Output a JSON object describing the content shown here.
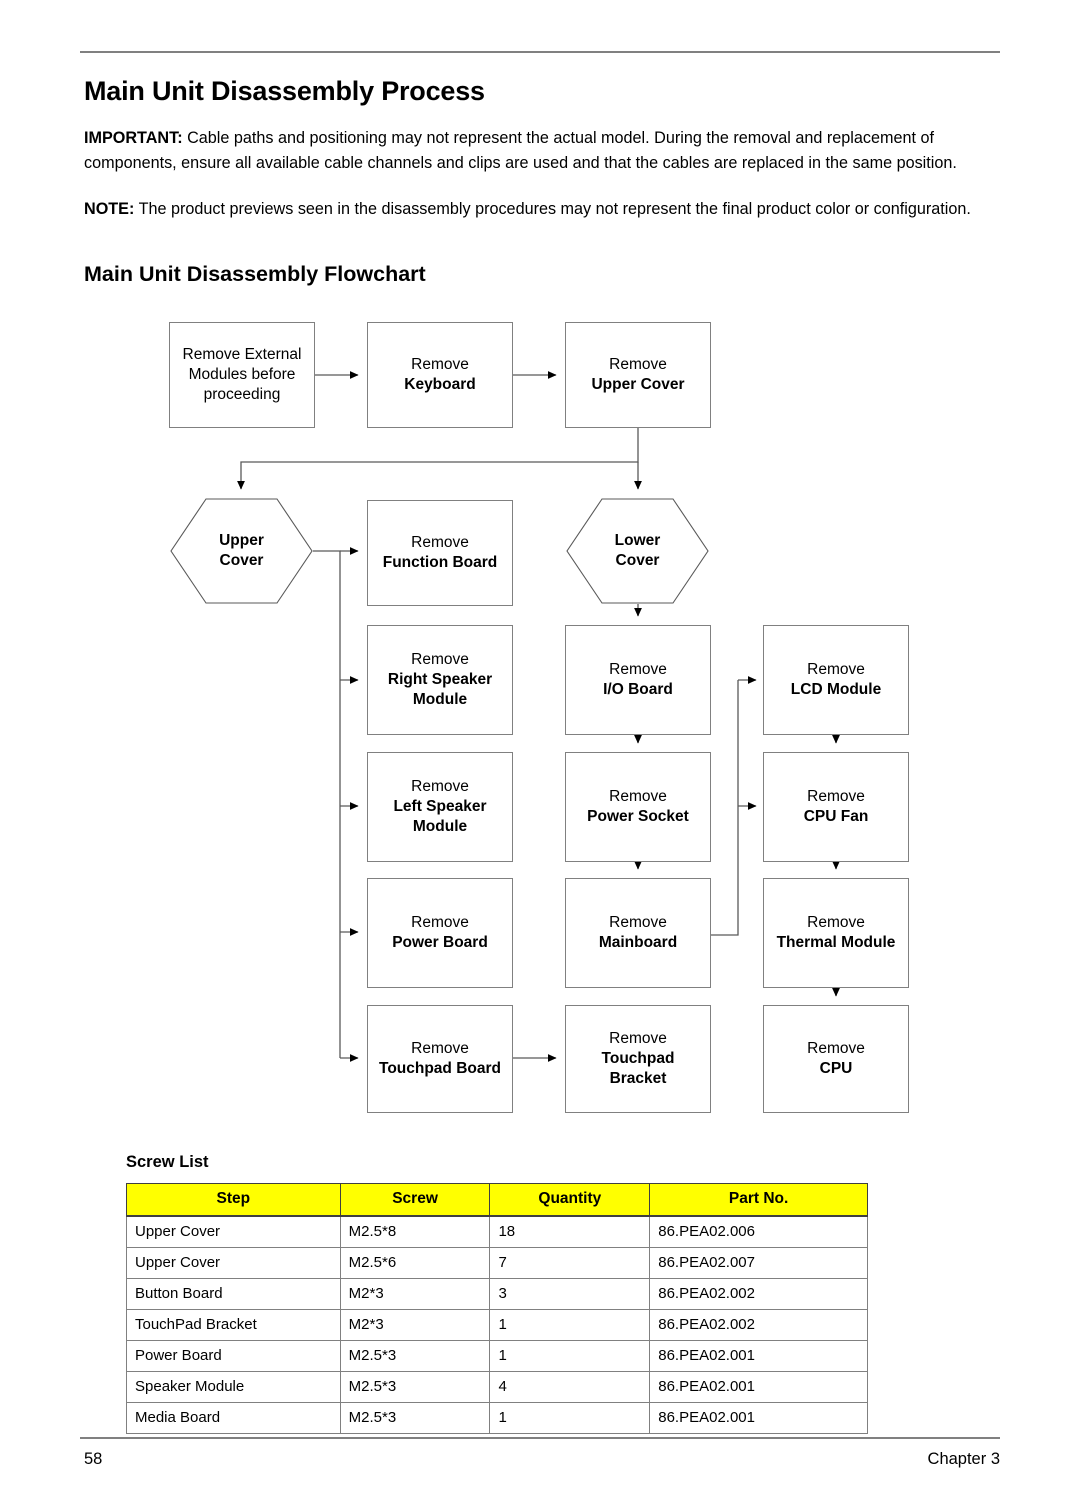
{
  "document": {
    "page_title": "Main Unit Disassembly Process",
    "section_title": "Main Unit Disassembly Flowchart",
    "important_label": "IMPORTANT:",
    "important_text": " Cable paths and positioning may not represent the actual model. During the removal and replacement of components, ensure all available cable channels and clips are used and that the cables are replaced in the same position.",
    "note_label": "NOTE:",
    "note_text": " The product previews seen in the disassembly procedures may not represent the final product color or configuration."
  },
  "flowchart": {
    "nodes": {
      "external_modules": {
        "line1": "Remove External",
        "line2": "Modules before",
        "line3": "proceeding"
      },
      "keyboard": {
        "line1": "Remove",
        "line2": "Keyboard"
      },
      "upper_cover_step": {
        "line1": "Remove",
        "line2": "Upper Cover"
      },
      "upper_cover_hex": {
        "line1": "Upper",
        "line2": "Cover"
      },
      "lower_cover_hex": {
        "line1": "Lower",
        "line2": "Cover"
      },
      "function_board": {
        "line1": "Remove",
        "line2": "Function Board"
      },
      "right_speaker": {
        "line1": "Remove",
        "line2": "Right Speaker",
        "line3": "Module"
      },
      "left_speaker": {
        "line1": "Remove",
        "line2": "Left Speaker",
        "line3": "Module"
      },
      "power_board": {
        "line1": "Remove",
        "line2": "Power Board"
      },
      "touchpad_board": {
        "line1": "Remove",
        "line2": "Touchpad Board"
      },
      "io_board": {
        "line1": "Remove",
        "line2": "I/O Board"
      },
      "power_socket": {
        "line1": "Remove",
        "line2": "Power Socket"
      },
      "mainboard": {
        "line1": "Remove",
        "line2": "Mainboard"
      },
      "touchpad_bracket": {
        "line1": "Remove",
        "line2": "Touchpad",
        "line3": "Bracket"
      },
      "lcd_module": {
        "line1": "Remove",
        "line2": "LCD Module"
      },
      "cpu_fan": {
        "line1": "Remove",
        "line2": "CPU Fan"
      },
      "thermal_module": {
        "line1": "Remove",
        "line2": "Thermal Module"
      },
      "cpu": {
        "line1": "Remove",
        "line2": "CPU"
      }
    },
    "colors": {
      "node_border": "#808080",
      "connector": "#595959"
    }
  },
  "screw_list": {
    "heading": "Screw List",
    "header_color": "#FFFF00",
    "columns": [
      "Step",
      "Screw",
      "Quantity",
      "Part No."
    ],
    "rows": [
      [
        "Upper Cover",
        "M2.5*8",
        "18",
        "86.PEA02.006"
      ],
      [
        "Upper Cover",
        "M2.5*6",
        "7",
        "86.PEA02.007"
      ],
      [
        "Button Board",
        "M2*3",
        "3",
        "86.PEA02.002"
      ],
      [
        "TouchPad Bracket",
        "M2*3",
        "1",
        "86.PEA02.002"
      ],
      [
        "Power Board",
        "M2.5*3",
        "1",
        "86.PEA02.001"
      ],
      [
        "Speaker Module",
        "M2.5*3",
        "4",
        "86.PEA02.001"
      ],
      [
        "Media Board",
        "M2.5*3",
        "1",
        "86.PEA02.001"
      ]
    ]
  },
  "footer": {
    "page_number": "58",
    "chapter": "Chapter 3"
  }
}
